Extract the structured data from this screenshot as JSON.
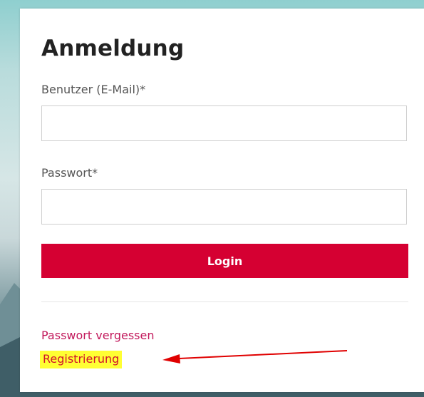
{
  "login": {
    "title": "Anmeldung",
    "user_label": "Benutzer (E-Mail)*",
    "user_value": "",
    "password_label": "Passwort*",
    "password_value": "",
    "login_button": "Login",
    "forgot_link": "Passwort vergessen",
    "register_link": "Registrierung"
  },
  "colors": {
    "brand_red": "#d50032",
    "link": "#c2185b",
    "highlight": "#ffff33",
    "annotation_arrow": "#e00000"
  }
}
